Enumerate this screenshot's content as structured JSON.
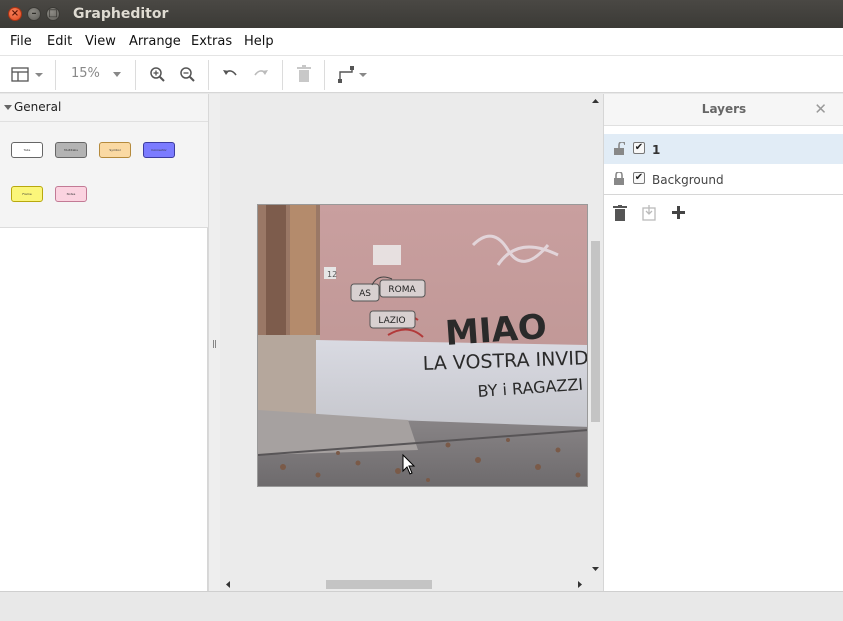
{
  "window": {
    "title": "Grapheditor"
  },
  "menu": [
    "File",
    "Edit",
    "View",
    "Arrange",
    "Extras",
    "Help"
  ],
  "toolbar": {
    "zoom": "15%",
    "icons": [
      "format-panel-icon",
      "zoom-in-icon",
      "zoom-out-icon",
      "undo-icon",
      "redo-icon",
      "delete-icon",
      "waypoints-icon"
    ]
  },
  "sidebar": {
    "section": "General",
    "shapes": [
      {
        "label": "Tabs",
        "fill": "#ffffff",
        "stroke": "#666666"
      },
      {
        "label": "Multitabs",
        "fill": "#b3b3b3",
        "stroke": "#666666"
      },
      {
        "label": "Symbol",
        "fill": "#fad9a3",
        "stroke": "#b58a3c"
      },
      {
        "label": "Connector",
        "fill": "#7b7bff",
        "stroke": "#3c3ca0"
      },
      {
        "label": "Frame",
        "fill": "#fbf67a",
        "stroke": "#b8a80e"
      },
      {
        "label": "Notes",
        "fill": "#fbd3e0",
        "stroke": "#c27a95"
      }
    ]
  },
  "canvas": {
    "labels": {
      "as": "AS",
      "roma": "ROMA",
      "lazio": "LAZIO"
    },
    "graffiti": {
      "line1": "MIAO",
      "line2": "LA VOSTRA INVIDIA E'",
      "line3": "BY i RAGAZZI DEL",
      "plate": "12"
    }
  },
  "layers": {
    "title": "Layers",
    "close": "✕",
    "items": [
      {
        "name": "1",
        "checked": "✔",
        "selected": true
      },
      {
        "name": "Background",
        "checked": "✔",
        "selected": false
      }
    ]
  },
  "colors": {
    "titlebar": "#3c3b37",
    "accent_close": "#e95420",
    "selection": "#e1ecf6"
  }
}
